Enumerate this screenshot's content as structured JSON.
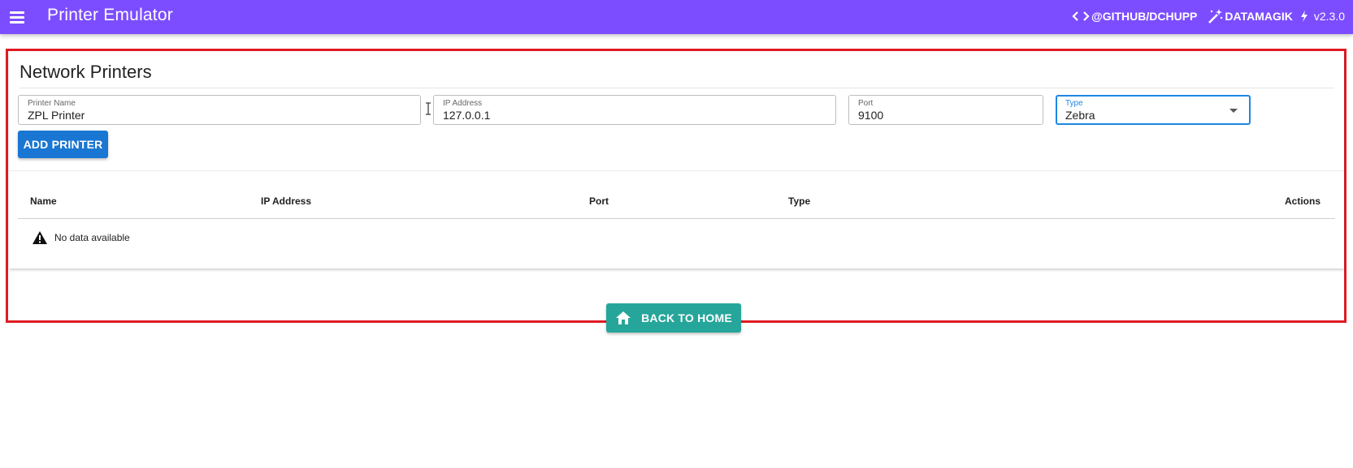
{
  "appbar": {
    "title": "Printer Emulator",
    "github_label": "@GITHUB/DCHUPP",
    "datamagik_label": "DATAMAGIK",
    "version": "v2.3.0",
    "color": "#7c4dff",
    "icons": [
      "menu-icon",
      "code-icon",
      "magic-wand-icon",
      "flash-icon"
    ]
  },
  "card": {
    "title": "Network Printers"
  },
  "form": {
    "printer_name": {
      "label": "Printer Name",
      "value": "ZPL Printer"
    },
    "ip_address": {
      "label": "IP Address",
      "value": "127.0.0.1"
    },
    "port": {
      "label": "Port",
      "value": "9100"
    },
    "type": {
      "label": "Type",
      "value": "Zebra"
    },
    "add_button": "ADD PRINTER",
    "add_button_color": "#1976d2"
  },
  "table": {
    "columns": [
      "Name",
      "IP Address",
      "Port",
      "Type",
      "Actions"
    ],
    "rows": [],
    "empty_text": "No data available"
  },
  "footer": {
    "home_button": "BACK TO HOME",
    "home_button_color": "#26a69a"
  },
  "highlight_color": "#e01b24"
}
